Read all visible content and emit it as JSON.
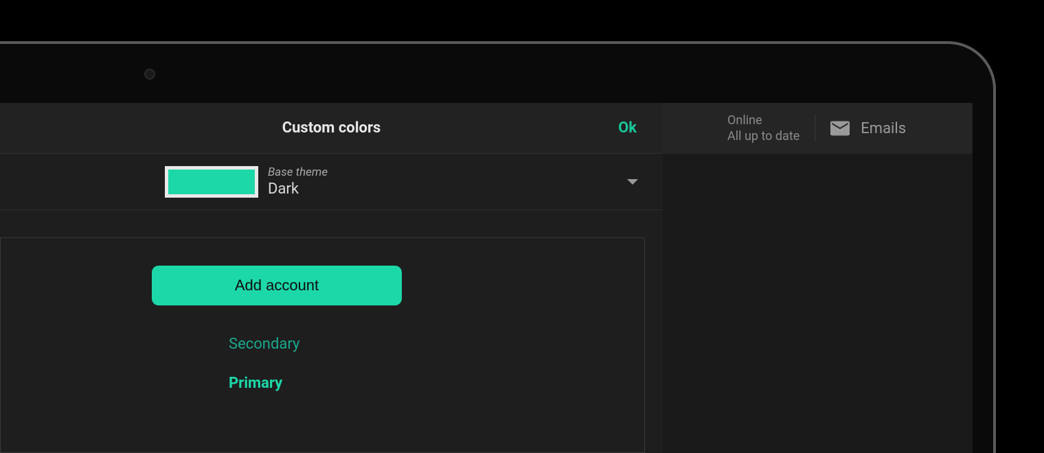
{
  "dialog": {
    "title": "Custom colors",
    "ok_label": "Ok",
    "base_theme": {
      "label": "Base theme",
      "value": "Dark",
      "swatch_color": "#1cd8a9"
    },
    "preview": {
      "add_account_label": "Add account",
      "secondary_label": "Secondary",
      "primary_label": "Primary"
    }
  },
  "status": {
    "line1": "Online",
    "line2": "All up to date",
    "emails_label": "Emails"
  }
}
